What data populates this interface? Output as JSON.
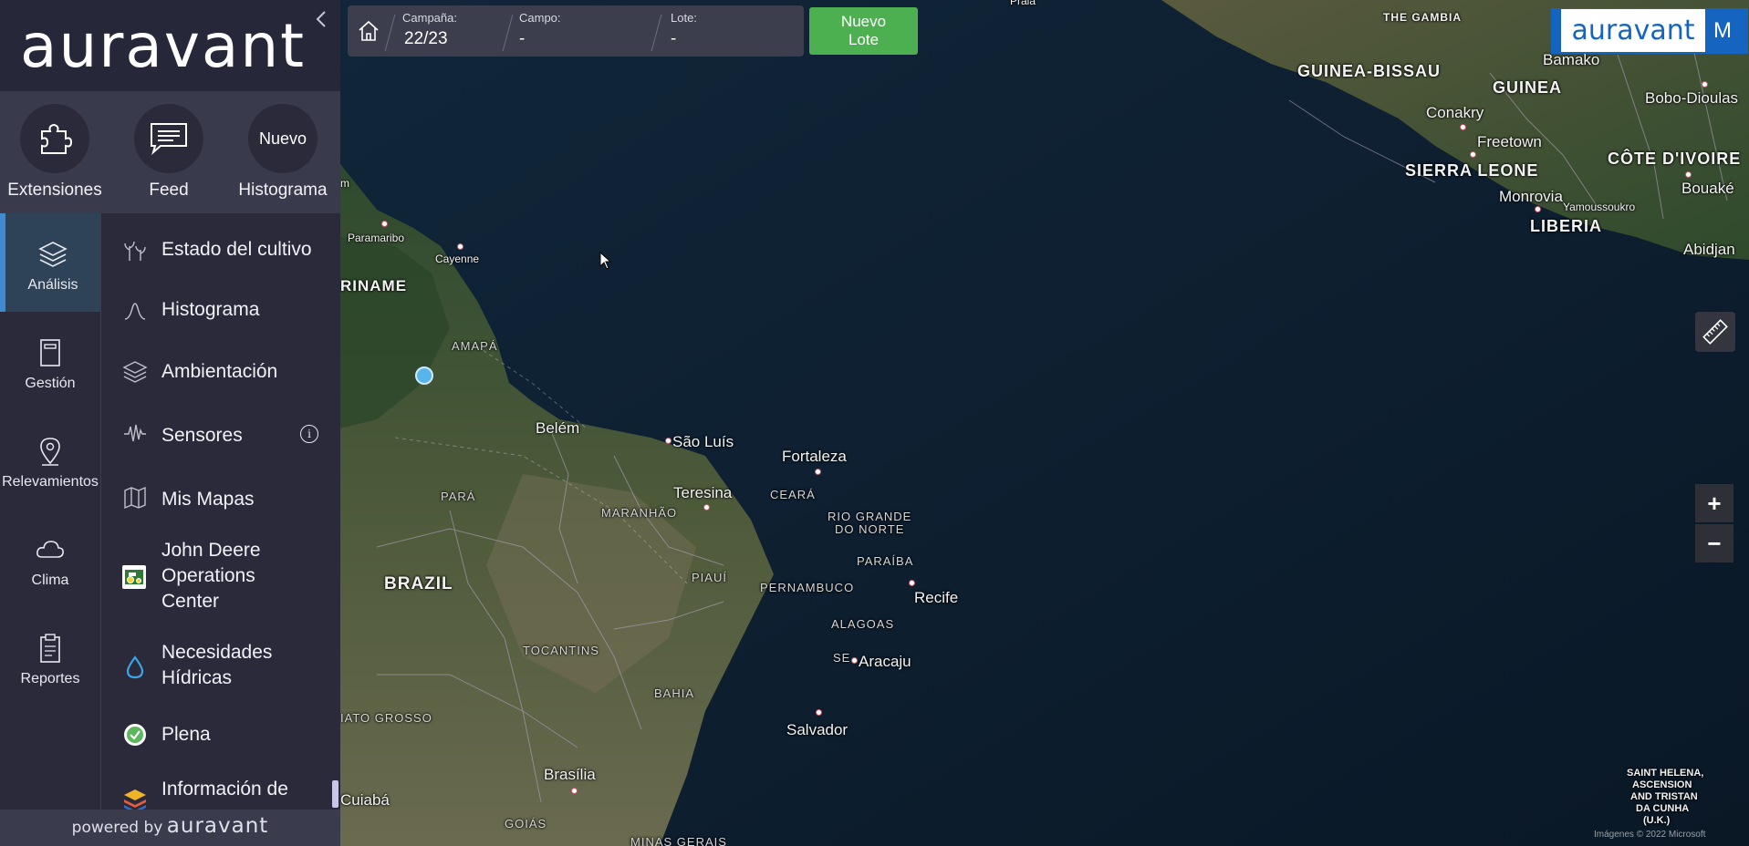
{
  "sidebar": {
    "logo": "auravant",
    "collapse_icon": "chevron-left-icon",
    "quick_actions": [
      {
        "label": "Extensiones",
        "icon": "puzzle-icon"
      },
      {
        "label": "Feed",
        "icon": "chat-icon"
      },
      {
        "label": "Histograma",
        "badge": "Nuevo"
      }
    ],
    "rail": [
      {
        "label": "Análisis",
        "icon": "layers-icon",
        "active": true
      },
      {
        "label": "Gestión",
        "icon": "notebook-icon"
      },
      {
        "label": "Relevamientos",
        "icon": "location-pin-icon"
      },
      {
        "label": "Clima",
        "icon": "cloud-icon"
      },
      {
        "label": "Reportes",
        "icon": "clipboard-icon"
      }
    ],
    "menu": [
      {
        "label": "Estado del cultivo",
        "icon": "plant-icon"
      },
      {
        "label": "Histograma",
        "icon": "histogram-curve-icon"
      },
      {
        "label": "Ambientación",
        "icon": "layers-icon"
      },
      {
        "label": "Sensores",
        "icon": "signal-wave-icon",
        "info_icon": "i"
      },
      {
        "label": "Mis Mapas",
        "icon": "map-icon"
      },
      {
        "label": "John Deere Operations Center",
        "lines": [
          "John Deere",
          "Operations",
          "Center"
        ],
        "icon": "tractor-icon"
      },
      {
        "label": "Necesidades Hídricas",
        "lines": [
          "Necesidades",
          "Hídricas"
        ],
        "icon": "water-drop-icon"
      },
      {
        "label": "Plena",
        "icon": "check-leaf-icon"
      },
      {
        "label": "Información de",
        "icon": "stack-icon"
      }
    ],
    "footer": {
      "prefix": "powered by",
      "brand": "auravant"
    }
  },
  "topbar": {
    "home_icon": "home-icon",
    "campana": {
      "label": "Campaña:",
      "value": "22/23"
    },
    "campo": {
      "label": "Campo:",
      "value": "-"
    },
    "lote": {
      "label": "Lote:",
      "value": "-"
    },
    "new_lote": "Nuevo Lote",
    "new_lote_lines": [
      "Nuevo",
      "Lote"
    ]
  },
  "brand_badge": {
    "logo": "auravant",
    "user_initial": "M"
  },
  "map": {
    "tools": {
      "ruler_icon": "ruler-icon",
      "zoom_in": "+",
      "zoom_out": "−"
    },
    "attribution": "Imágenes © 2022 Microsoft",
    "labels": {
      "gambia": "THE GAMBIA",
      "bamako": "Bamako",
      "guinea_bissau": "GUINEA-BISSAU",
      "guinea": "GUINEA",
      "bobo": "Bobo-Dioulas",
      "conakry": "Conakry",
      "freetown": "Freetown",
      "cote": "CÔTE D'IVOIRE",
      "sierra": "SIERRA LEONE",
      "monrovia": "Monrovia",
      "bouake": "Bouaké",
      "yamoussoukro": "Yamoussoukro",
      "liberia": "LIBERIA",
      "abidjan": "Abidjan",
      "paramaribo": "Paramaribo",
      "cayenne": "Cayenne",
      "suriname": "RINAME",
      "amapa": "AMAPÁ",
      "belem": "Belém",
      "sao_luis": "São Luís",
      "fortaleza": "Fortaleza",
      "para": "PARÁ",
      "teresina": "Teresina",
      "ceara": "CEARÁ",
      "maranhao": "MARANHÃO",
      "rgn1": "RIO GRANDE",
      "rgn2": "DO NORTE",
      "paraiba": "PARAÍBA",
      "brazil": "BRAZIL",
      "piaui": "PIAUÍ",
      "pernambuco": "PERNAMBUCO",
      "recife": "Recife",
      "alagoas": "ALAGOAS",
      "tocantins": "TOCANTINS",
      "se": "SE",
      "aracaju": "Aracaju",
      "bahia": "BAHIA",
      "mato_grosso": "IATO GROSSO",
      "salvador": "Salvador",
      "brasilia": "Brasília",
      "cuiaba": "Cuiabá",
      "goias": "GOIÁS",
      "minas": "MINAS GERAIS",
      "saint1": "SAINT HELENA,",
      "saint2": "ASCENSION",
      "saint3": "AND TRISTAN",
      "saint4": "DA CUNHA",
      "saint5": "(U.K.)",
      "edge_m": "m",
      "praia": "Praia"
    }
  }
}
